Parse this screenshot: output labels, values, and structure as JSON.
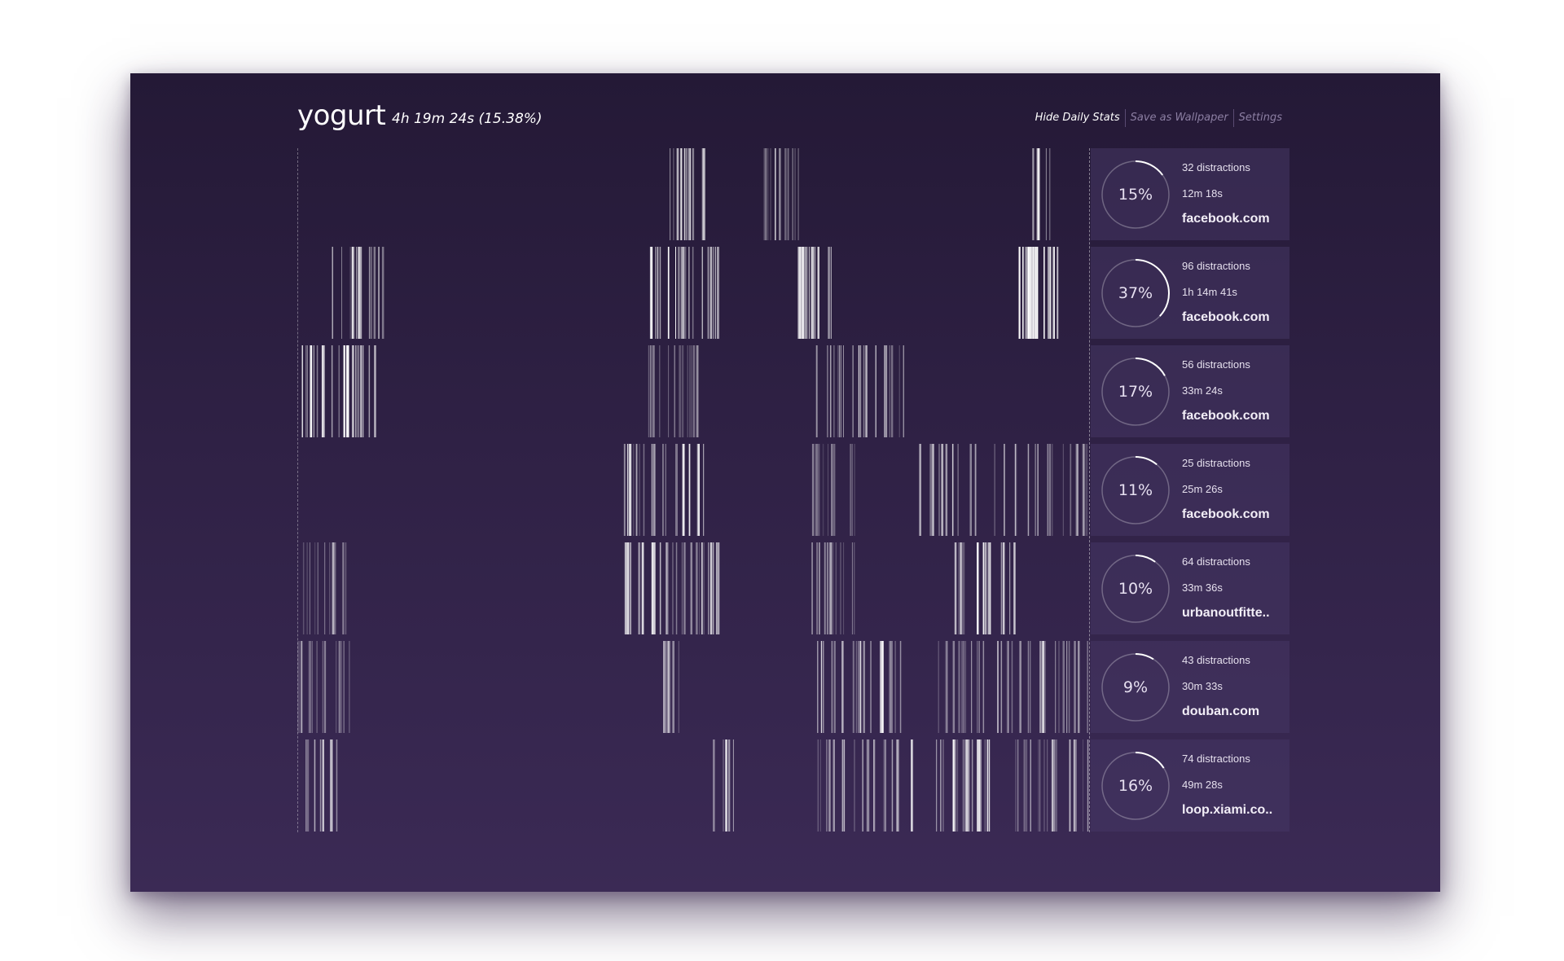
{
  "app": {
    "title": "yogurt",
    "summary": "4h 19m 24s (15.38%)"
  },
  "nav": {
    "items": [
      {
        "label": "Hide Daily Stats"
      },
      {
        "label": "Save as Wallpaper"
      },
      {
        "label": "Settings"
      }
    ]
  },
  "colors": {
    "background_top": "#241936",
    "background_bottom": "#3b2a55",
    "card": "#463764",
    "accent": "#ffffff"
  },
  "days": [
    {
      "percent_label": "15%",
      "percent": 15,
      "distractions": "32 distractions",
      "time": "12m 18s",
      "domain": "facebook.com",
      "clusters": [
        [
          455,
          500,
          0.55,
          22
        ],
        [
          570,
          615,
          0.45,
          14
        ],
        [
          900,
          925,
          0.75,
          6
        ]
      ]
    },
    {
      "percent_label": "37%",
      "percent": 37,
      "distractions": "96 distractions",
      "time": "1h 14m 41s",
      "domain": "facebook.com",
      "clusters": [
        [
          25,
          120,
          0.6,
          18
        ],
        [
          430,
          520,
          0.8,
          24
        ],
        [
          612,
          655,
          0.85,
          16
        ],
        [
          885,
          935,
          0.95,
          30
        ]
      ]
    },
    {
      "percent_label": "17%",
      "percent": 17,
      "distractions": "56 distractions",
      "time": "33m 24s",
      "domain": "facebook.com",
      "clusters": [
        [
          0,
          95,
          0.85,
          28
        ],
        [
          425,
          495,
          0.4,
          16
        ],
        [
          635,
          745,
          0.6,
          26
        ]
      ]
    },
    {
      "percent_label": "11%",
      "percent": 11,
      "distractions": "25 distractions",
      "time": "25m 26s",
      "domain": "facebook.com",
      "clusters": [
        [
          400,
          505,
          0.65,
          28
        ],
        [
          630,
          690,
          0.35,
          14
        ],
        [
          750,
          972,
          0.55,
          34
        ]
      ]
    },
    {
      "percent_label": "10%",
      "percent": 10,
      "distractions": "64 distractions",
      "time": "33m 36s",
      "domain": "urbanoutfitte..",
      "clusters": [
        [
          0,
          60,
          0.35,
          14
        ],
        [
          400,
          525,
          0.7,
          32
        ],
        [
          630,
          695,
          0.45,
          20
        ],
        [
          805,
          880,
          0.75,
          20
        ]
      ]
    },
    {
      "percent_label": "9%",
      "percent": 9,
      "distractions": "43 distractions",
      "time": "30m 33s",
      "domain": "douban.com",
      "clusters": [
        [
          0,
          65,
          0.3,
          22
        ],
        [
          430,
          470,
          0.55,
          8
        ],
        [
          635,
          740,
          0.65,
          26
        ],
        [
          780,
          972,
          0.55,
          34
        ]
      ]
    },
    {
      "percent_label": "16%",
      "percent": 16,
      "distractions": "74 distractions",
      "time": "49m 28s",
      "domain": "loop.xiami.co..",
      "clusters": [
        [
          8,
          50,
          0.6,
          10
        ],
        [
          510,
          535,
          0.9,
          5
        ],
        [
          635,
          755,
          0.55,
          24
        ],
        [
          780,
          850,
          0.75,
          22
        ],
        [
          880,
          972,
          0.45,
          26
        ]
      ]
    }
  ]
}
